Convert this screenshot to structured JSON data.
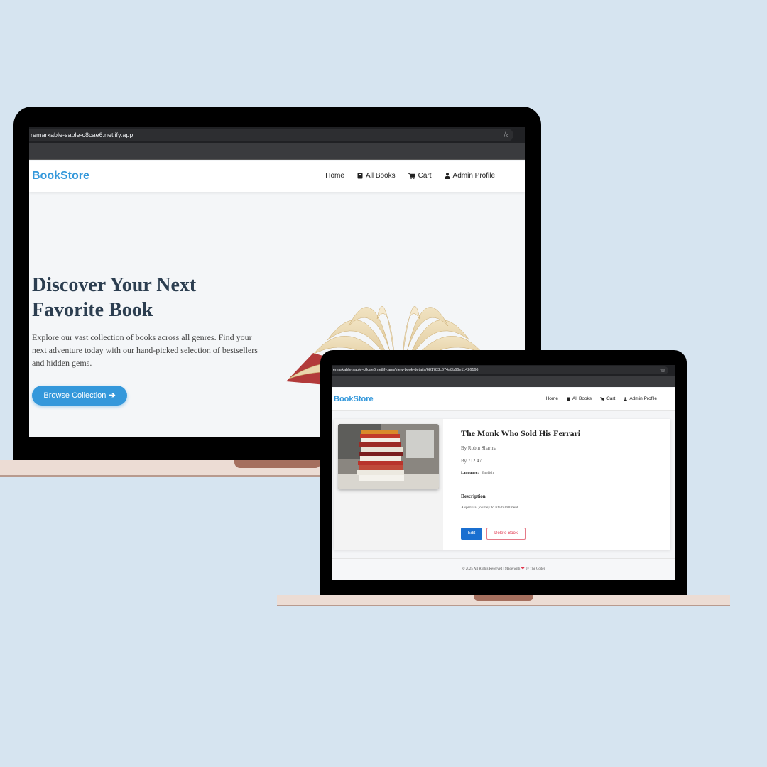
{
  "desktop": {
    "browser": {
      "url": "remarkable-sable-c8cae6.netlify.app",
      "star_icon": "star-icon"
    },
    "nav": {
      "logo": "BookStore",
      "links": [
        {
          "label": "Home",
          "icon": ""
        },
        {
          "label": "All Books",
          "icon": "book-icon"
        },
        {
          "label": "Cart",
          "icon": "cart-icon"
        },
        {
          "label": "Admin Profile",
          "icon": "user-icon"
        }
      ]
    },
    "hero": {
      "title": "Discover Your Next Favorite Book",
      "text": "Explore our vast collection of books across all genres. Find your next adventure today with our hand-picked selection of bestsellers and hidden gems.",
      "button_label": "Browse Collection",
      "button_icon": "arrow-right-icon"
    }
  },
  "laptop": {
    "browser": {
      "url": "remarkable-sable-c8cae6.netlify.app/view-book-details/681783c674a8b66e11426166"
    },
    "nav": {
      "logo": "BookStore",
      "links": [
        {
          "label": "Home"
        },
        {
          "label": "All Books"
        },
        {
          "label": "Cart"
        },
        {
          "label": "Admin Profile"
        }
      ]
    },
    "book": {
      "title": "The Monk Who Sold His Ferrari",
      "author": "By Robin Sharma",
      "price": "By 712.47",
      "language_label": "Language:",
      "language_value": "English",
      "description_heading": "Description",
      "description_text": "A spiritual journey to life fulfillment.",
      "edit_label": "Edit",
      "delete_label": "Delete Book"
    },
    "footer": {
      "text_before": "© 2025 All Rights Reserved | Made with",
      "text_after": "by The Coder"
    }
  },
  "colors": {
    "background": "#d6e4f0",
    "brand": "#3498db",
    "heading": "#2c3e50",
    "edit": "#1a6fd0",
    "delete": "#e0344b"
  }
}
